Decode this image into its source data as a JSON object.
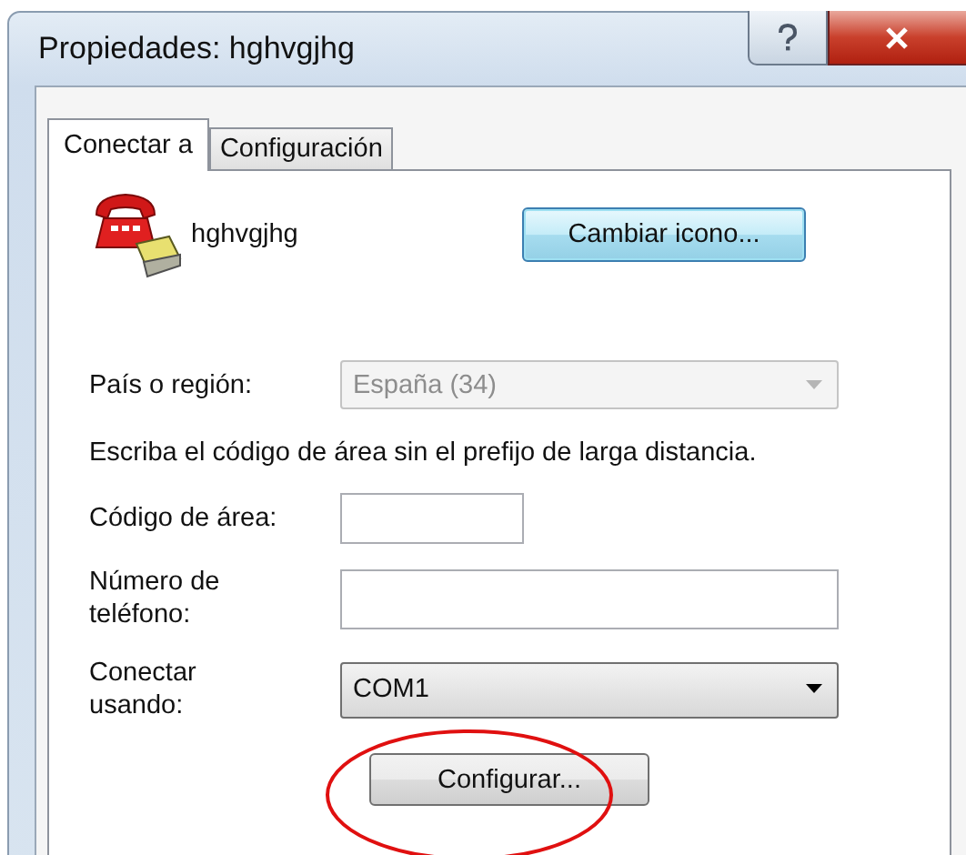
{
  "window": {
    "title": "Propiedades: hghvgjhg"
  },
  "tabs": [
    {
      "label": "Conectar a",
      "selected": true
    },
    {
      "label": "Configuración",
      "selected": false
    }
  ],
  "connection": {
    "name": "hghvgjhg",
    "change_icon_button": "Cambiar icono..."
  },
  "country": {
    "label": "País o región:",
    "value": "España (34)",
    "disabled": true
  },
  "instruction": "Escriba el código de área sin el prefijo de larga distancia.",
  "area_code": {
    "label": "Código de área:"
  },
  "phone_number": {
    "label": "Número de teléfono:"
  },
  "connect_using": {
    "label": "Conectar usando:",
    "value": "COM1",
    "disabled": false
  },
  "configure_button": "Configurar..."
}
